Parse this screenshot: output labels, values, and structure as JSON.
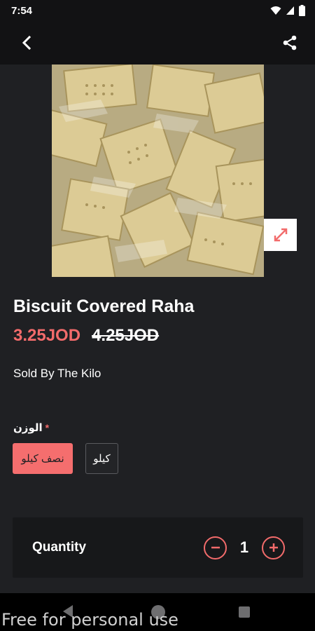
{
  "status_bar": {
    "time": "7:54"
  },
  "product": {
    "title": "Biscuit Covered Raha",
    "price_current": "3.25JOD",
    "price_old": "4.25JOD",
    "sold_by": "Sold By The Kilo"
  },
  "options": {
    "label": "الوزن",
    "required_mark": "*",
    "choices": [
      "نصف كيلو",
      "كيلو"
    ],
    "selected_index": 0
  },
  "quantity": {
    "label": "Quantity",
    "value": "1"
  },
  "watermark": "Free for personal use",
  "colors": {
    "accent": "#f26b6b",
    "background": "#1f2023",
    "bar": "#121214"
  }
}
